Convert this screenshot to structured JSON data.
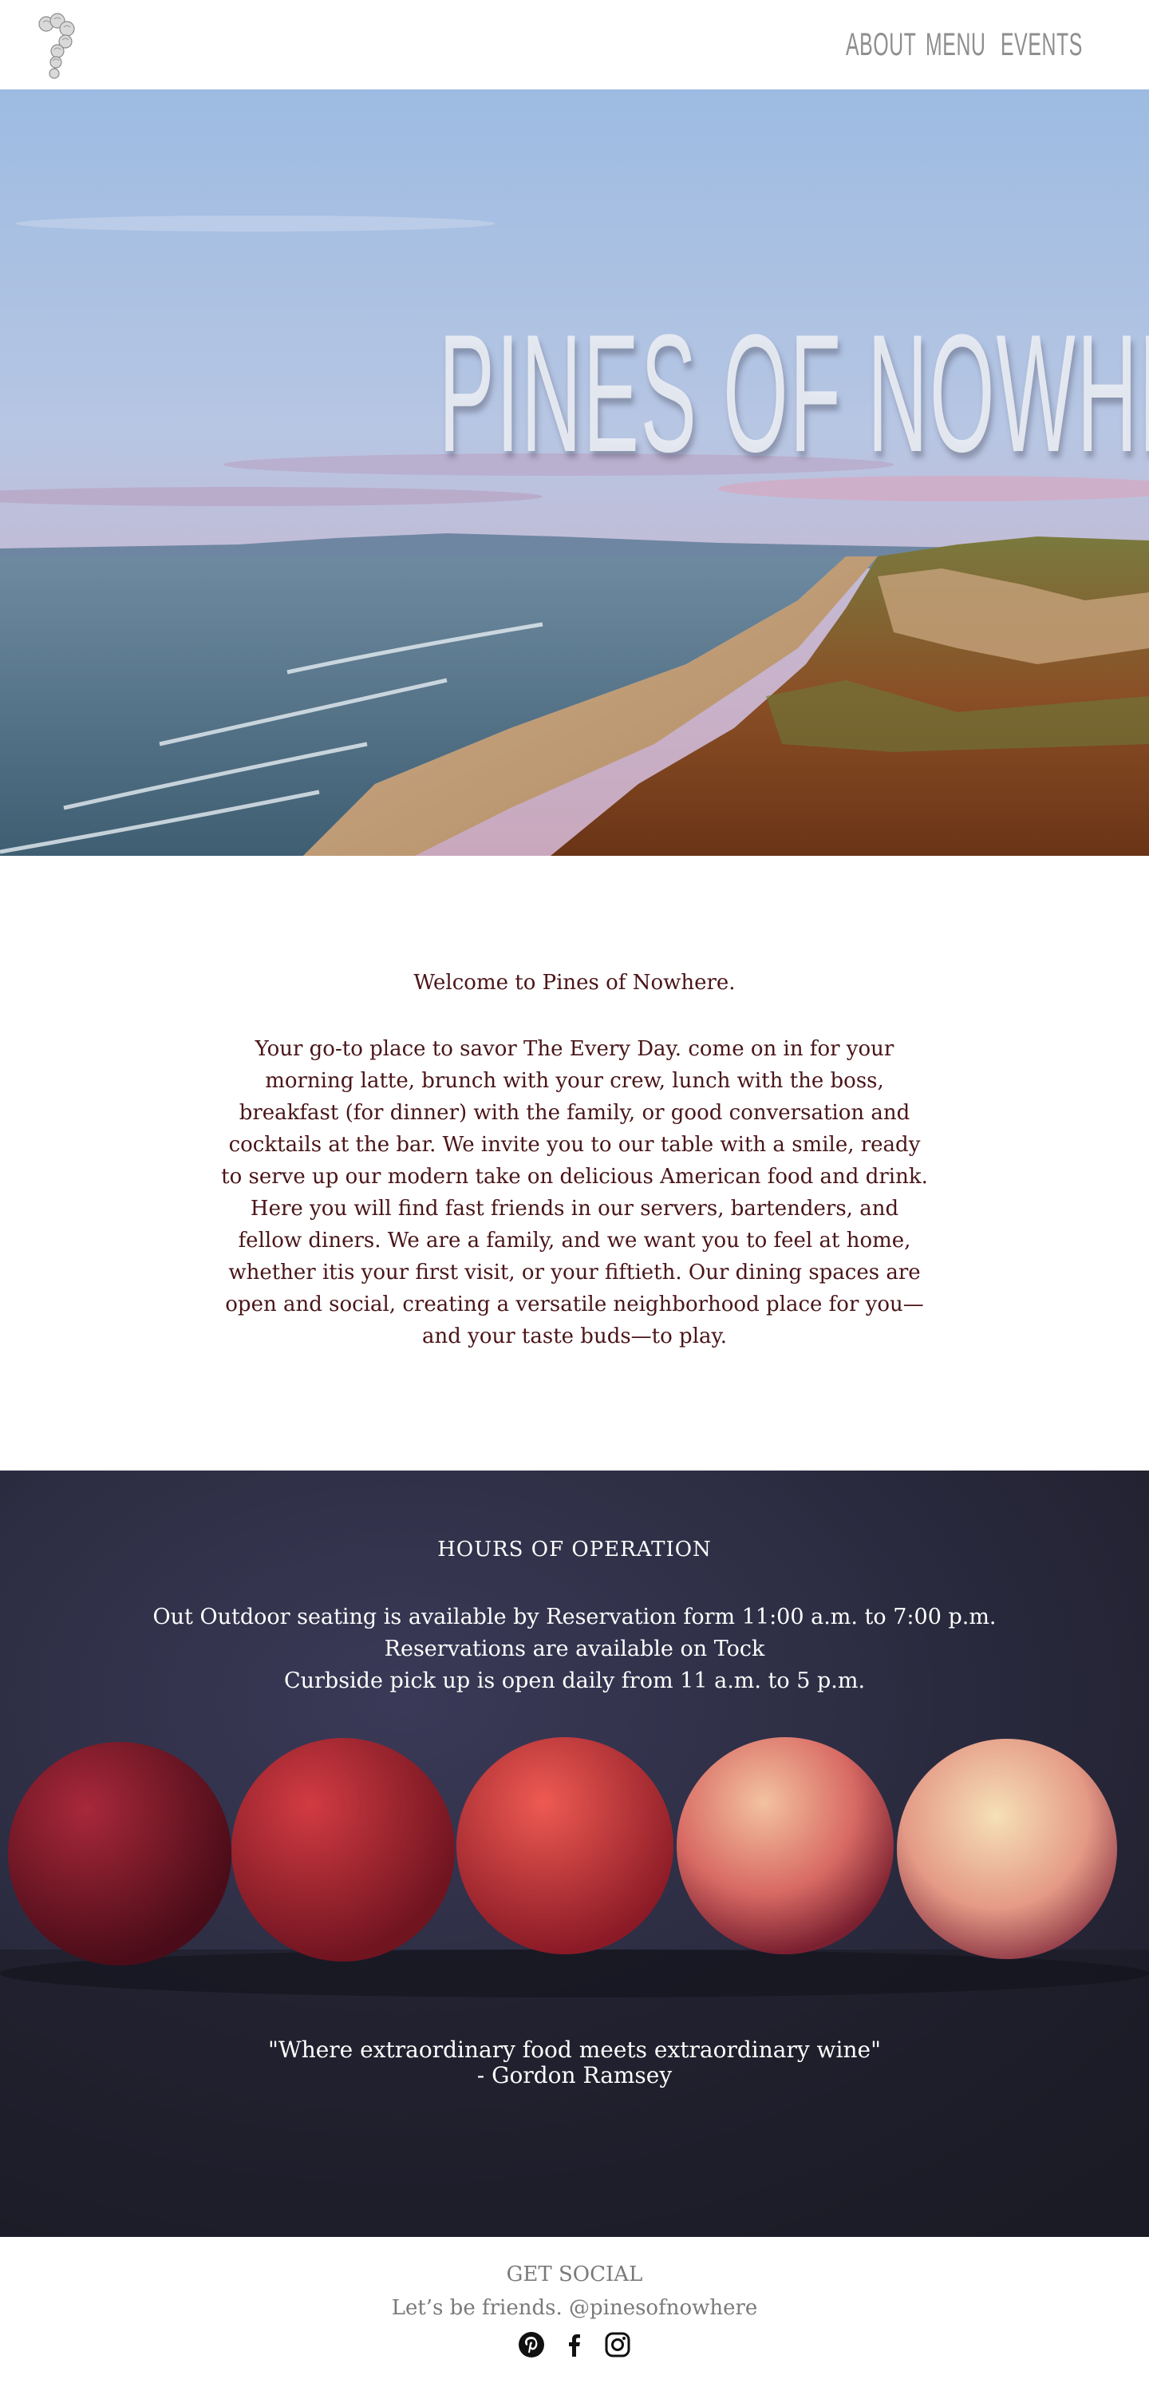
{
  "header": {
    "logo_icon": "flower-question-mark-logo",
    "nav": [
      {
        "label": "ABOUT"
      },
      {
        "label": "MENU"
      },
      {
        "label": "EVENTS"
      }
    ]
  },
  "hero": {
    "title": "PINES OF NOWHERE",
    "image": "coastal-beach-sunset-photo"
  },
  "welcome": {
    "title": "Welcome to Pines of Nowhere.",
    "body": "Your go-to place to savor The Every Day. come on in for your morning latte, brunch with your crew, lunch with the boss, breakfast (for dinner) with the family, or good conversation and cocktails at the bar. We invite you to our table with a smile, ready to serve up our modern take on delicious American food and drink. Here you will find fast friends in our servers, bartenders, and fellow diners. We are a family, and we want you to feel at home, whether itis your first visit, or your fiftieth. Our dining spaces are open and social, creating a versatile neighborhood place for you—and your taste buds—to play."
  },
  "hours": {
    "title": "HOURS OF OPERATION",
    "lines": [
      "Out Outdoor seating is available by Reservation form 11:00 a.m. to 7:00 p.m.",
      "Reservations are available on Tock",
      "Curbside pick up is open daily from 11 a.m. to 5 p.m."
    ],
    "image": "row-of-nectarines-photo",
    "quote": "\"Where extraordinary food meets extraordinary wine\"",
    "quote_author": "- Gordon Ramsey"
  },
  "footer": {
    "title": "GET SOCIAL",
    "subtitle": "Let’s be friends. @pinesofnowhere",
    "icons": [
      "pinterest-icon",
      "facebook-icon",
      "instagram-icon"
    ]
  },
  "colors": {
    "body_text": "#4a1518",
    "nav_text": "#8e8e8e",
    "footer_text": "#7a7a7a",
    "hours_bg": "#24243a"
  }
}
